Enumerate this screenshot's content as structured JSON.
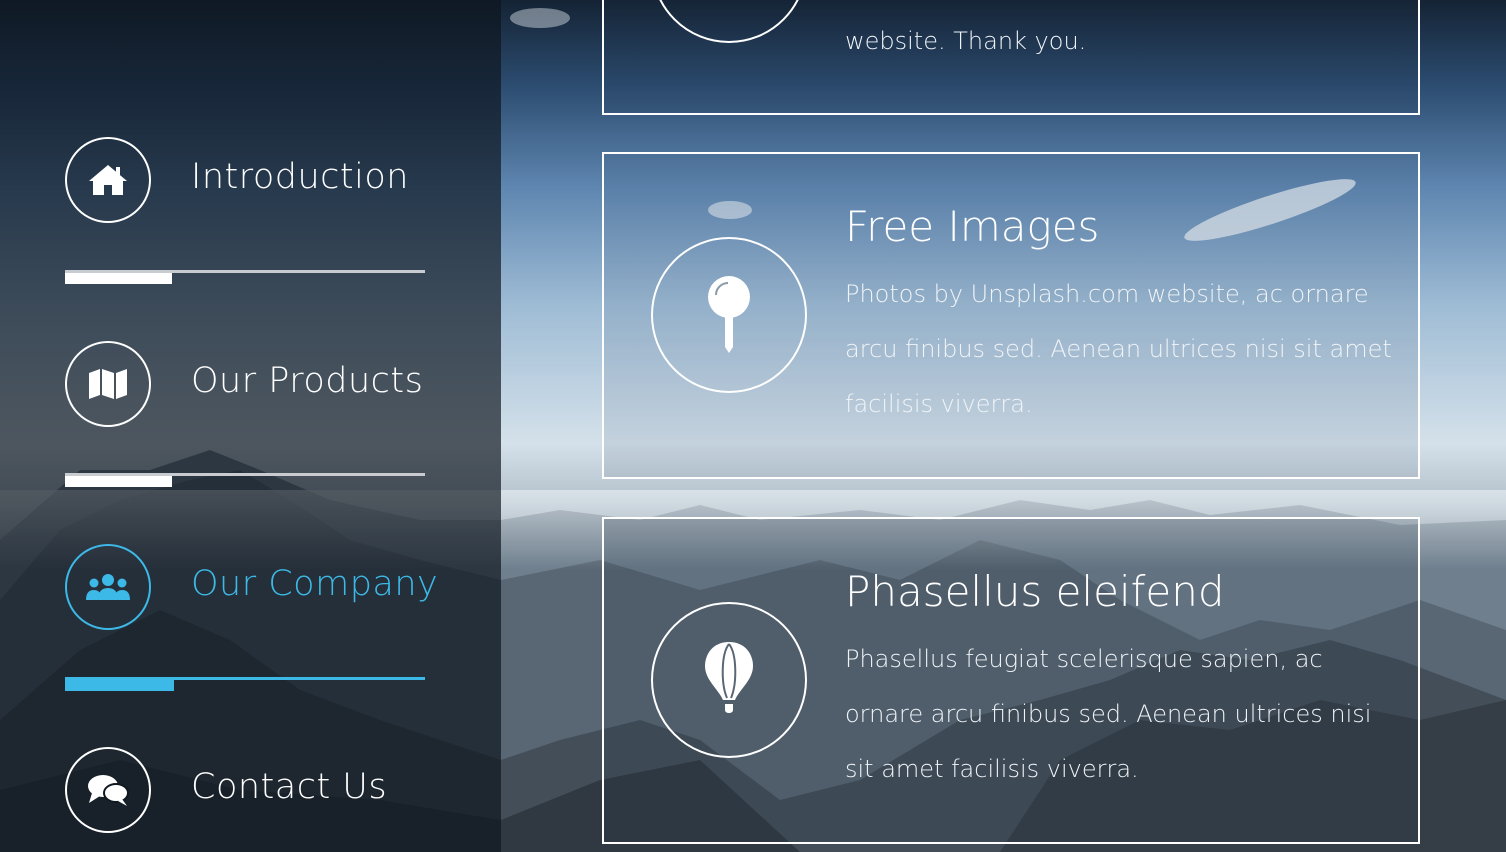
{
  "sidebar": {
    "items": [
      {
        "label": "Introduction",
        "icon": "home-icon",
        "active": false
      },
      {
        "label": "Our Products",
        "icon": "map-icon",
        "active": false
      },
      {
        "label": "Our Company",
        "icon": "users-icon",
        "active": true
      },
      {
        "label": "Contact Us",
        "icon": "comments-icon",
        "active": false
      }
    ],
    "accent_color": "#3db9e8"
  },
  "cards": [
    {
      "text": "website. Thank you.",
      "icon": "partial-circle-icon"
    },
    {
      "title": "Free Images",
      "text": "Photos by Unsplash.com website, ac ornare arcu finibus sed. Aenean ultrices nisi sit amet facilisis viverra.",
      "icon": "map-pin-icon"
    },
    {
      "title": "Phasellus eleifend",
      "text": "Phasellus feugiat scelerisque sapien, ac ornare arcu finibus sed. Aenean ultrices nisi sit amet facilisis viverra.",
      "icon": "hot-air-balloon-icon"
    }
  ]
}
